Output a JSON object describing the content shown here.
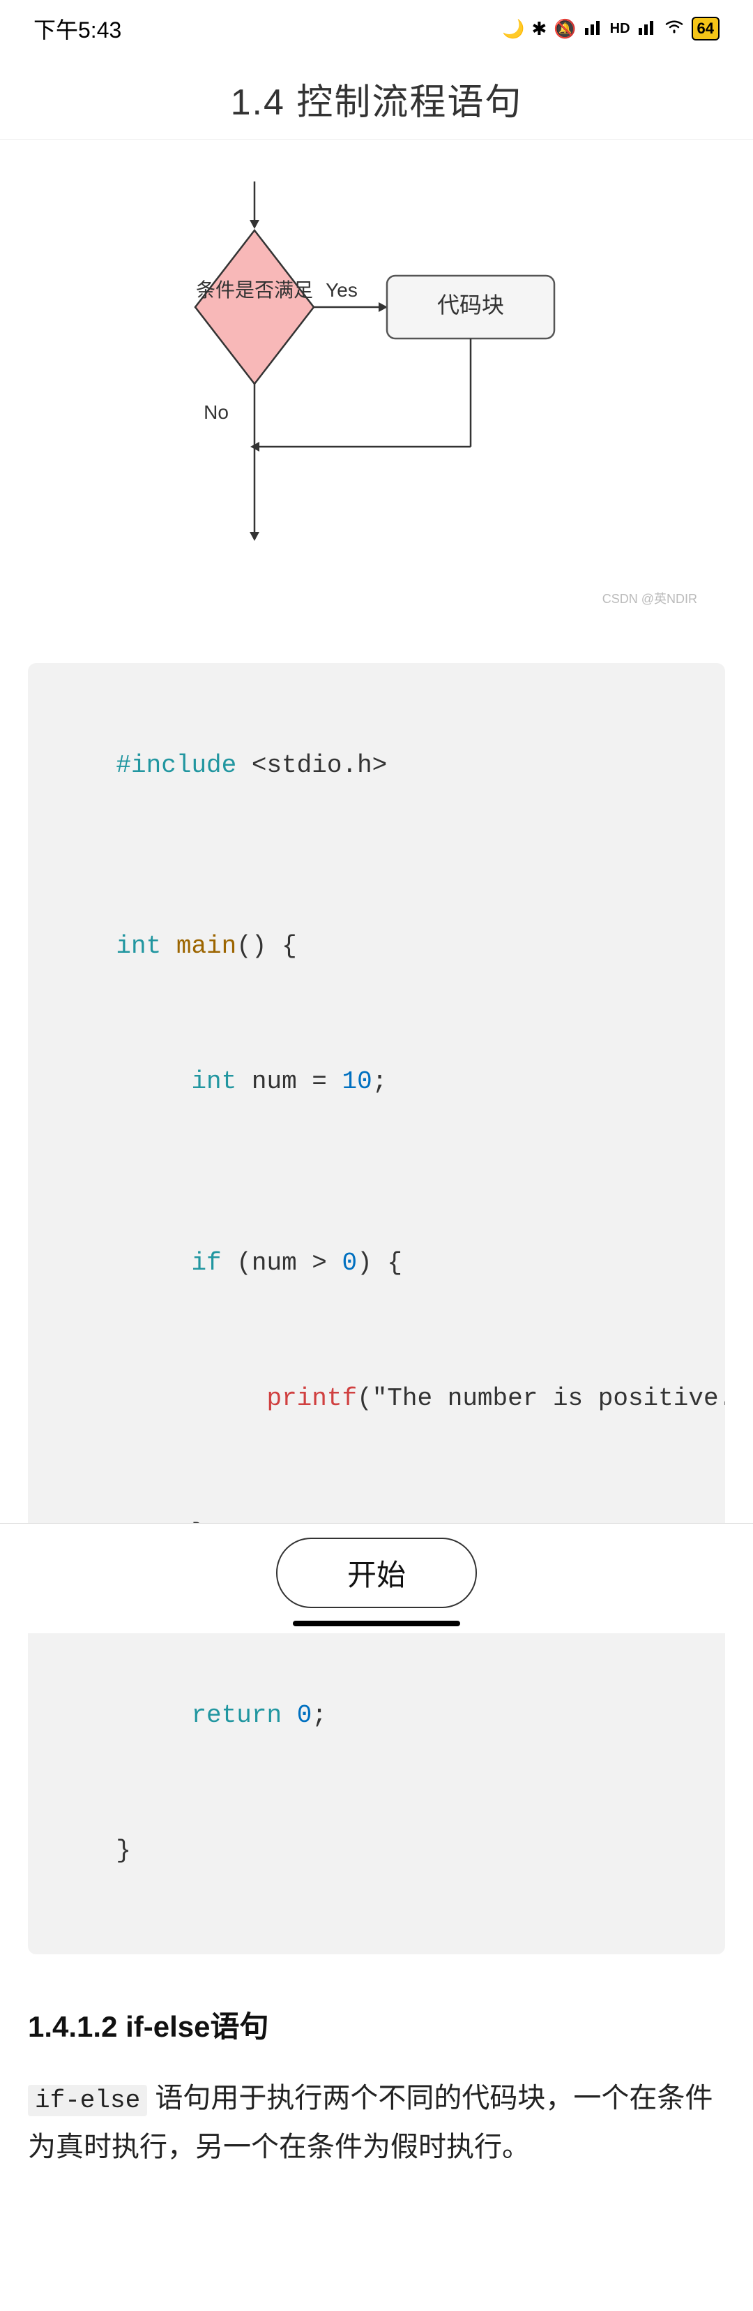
{
  "statusBar": {
    "time": "下午5:43",
    "battery": "64"
  },
  "header": {
    "title": "1.4 控制流程语句"
  },
  "flowchart": {
    "diamondLabel": "条件是否满足",
    "codeBlockLabel": "代码块",
    "yesLabel": "Yes",
    "noLabel": "No",
    "watermark": "CSDN @英NDIR"
  },
  "codeBlock": {
    "lines": [
      {
        "id": "l1",
        "tokens": [
          {
            "text": "#include",
            "cls": "c-include"
          },
          {
            "text": " <stdio.h>",
            "cls": "c-plain"
          }
        ]
      },
      {
        "id": "l2",
        "tokens": []
      },
      {
        "id": "l3",
        "tokens": [
          {
            "text": "int",
            "cls": "c-keyword"
          },
          {
            "text": " ",
            "cls": "c-plain"
          },
          {
            "text": "main",
            "cls": "c-funcname"
          },
          {
            "text": "() {",
            "cls": "c-plain"
          }
        ]
      },
      {
        "id": "l4",
        "tokens": [
          {
            "text": "    ",
            "cls": "c-plain"
          },
          {
            "text": "int",
            "cls": "c-keyword"
          },
          {
            "text": " num = ",
            "cls": "c-plain"
          },
          {
            "text": "10",
            "cls": "c-number"
          },
          {
            "text": ";",
            "cls": "c-plain"
          }
        ]
      },
      {
        "id": "l5",
        "tokens": []
      },
      {
        "id": "l6",
        "tokens": [
          {
            "text": "    ",
            "cls": "c-plain"
          },
          {
            "text": "if",
            "cls": "c-keyword"
          },
          {
            "text": " (num > ",
            "cls": "c-plain"
          },
          {
            "text": "0",
            "cls": "c-number"
          },
          {
            "text": ") {",
            "cls": "c-plain"
          }
        ]
      },
      {
        "id": "l7",
        "tokens": [
          {
            "text": "        ",
            "cls": "c-plain"
          },
          {
            "text": "printf",
            "cls": "c-string"
          },
          {
            "text": "(\"The number is positive.\\",
            "cls": "c-plain"
          }
        ]
      },
      {
        "id": "l8",
        "tokens": [
          {
            "text": "    }",
            "cls": "c-plain"
          }
        ]
      },
      {
        "id": "l9",
        "tokens": []
      },
      {
        "id": "l10",
        "tokens": [
          {
            "text": "    ",
            "cls": "c-plain"
          },
          {
            "text": "return",
            "cls": "c-keyword"
          },
          {
            "text": " ",
            "cls": "c-plain"
          },
          {
            "text": "0",
            "cls": "c-number"
          },
          {
            "text": ";",
            "cls": "c-plain"
          }
        ]
      },
      {
        "id": "l11",
        "tokens": [
          {
            "text": "}",
            "cls": "c-plain"
          }
        ]
      }
    ]
  },
  "sectionHeading": "1.4.1.2 if-else语句",
  "descriptionText": "if-else 语句用于执行两个不同的代码块，一个在条件为真时执行，另一个在条件为假时执行。",
  "inlineCode": "if-else",
  "bottomButton": {
    "label": "开始"
  }
}
